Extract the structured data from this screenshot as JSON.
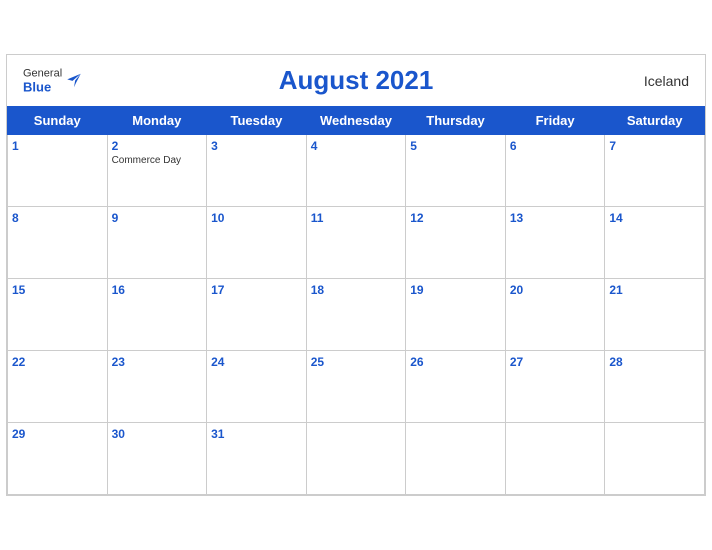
{
  "header": {
    "logo": {
      "general": "General",
      "blue": "Blue",
      "bird_unicode": "🐦"
    },
    "title": "August 2021",
    "country": "Iceland"
  },
  "weekdays": [
    "Sunday",
    "Monday",
    "Tuesday",
    "Wednesday",
    "Thursday",
    "Friday",
    "Saturday"
  ],
  "weeks": [
    [
      {
        "day": "1",
        "event": ""
      },
      {
        "day": "2",
        "event": "Commerce Day"
      },
      {
        "day": "3",
        "event": ""
      },
      {
        "day": "4",
        "event": ""
      },
      {
        "day": "5",
        "event": ""
      },
      {
        "day": "6",
        "event": ""
      },
      {
        "day": "7",
        "event": ""
      }
    ],
    [
      {
        "day": "8",
        "event": ""
      },
      {
        "day": "9",
        "event": ""
      },
      {
        "day": "10",
        "event": ""
      },
      {
        "day": "11",
        "event": ""
      },
      {
        "day": "12",
        "event": ""
      },
      {
        "day": "13",
        "event": ""
      },
      {
        "day": "14",
        "event": ""
      }
    ],
    [
      {
        "day": "15",
        "event": ""
      },
      {
        "day": "16",
        "event": ""
      },
      {
        "day": "17",
        "event": ""
      },
      {
        "day": "18",
        "event": ""
      },
      {
        "day": "19",
        "event": ""
      },
      {
        "day": "20",
        "event": ""
      },
      {
        "day": "21",
        "event": ""
      }
    ],
    [
      {
        "day": "22",
        "event": ""
      },
      {
        "day": "23",
        "event": ""
      },
      {
        "day": "24",
        "event": ""
      },
      {
        "day": "25",
        "event": ""
      },
      {
        "day": "26",
        "event": ""
      },
      {
        "day": "27",
        "event": ""
      },
      {
        "day": "28",
        "event": ""
      }
    ],
    [
      {
        "day": "29",
        "event": ""
      },
      {
        "day": "30",
        "event": ""
      },
      {
        "day": "31",
        "event": ""
      },
      {
        "day": "",
        "event": ""
      },
      {
        "day": "",
        "event": ""
      },
      {
        "day": "",
        "event": ""
      },
      {
        "day": "",
        "event": ""
      }
    ]
  ],
  "colors": {
    "header_bg": "#1a56cc",
    "header_text": "#ffffff",
    "day_number": "#1a56cc",
    "cell_border": "#cccccc"
  }
}
